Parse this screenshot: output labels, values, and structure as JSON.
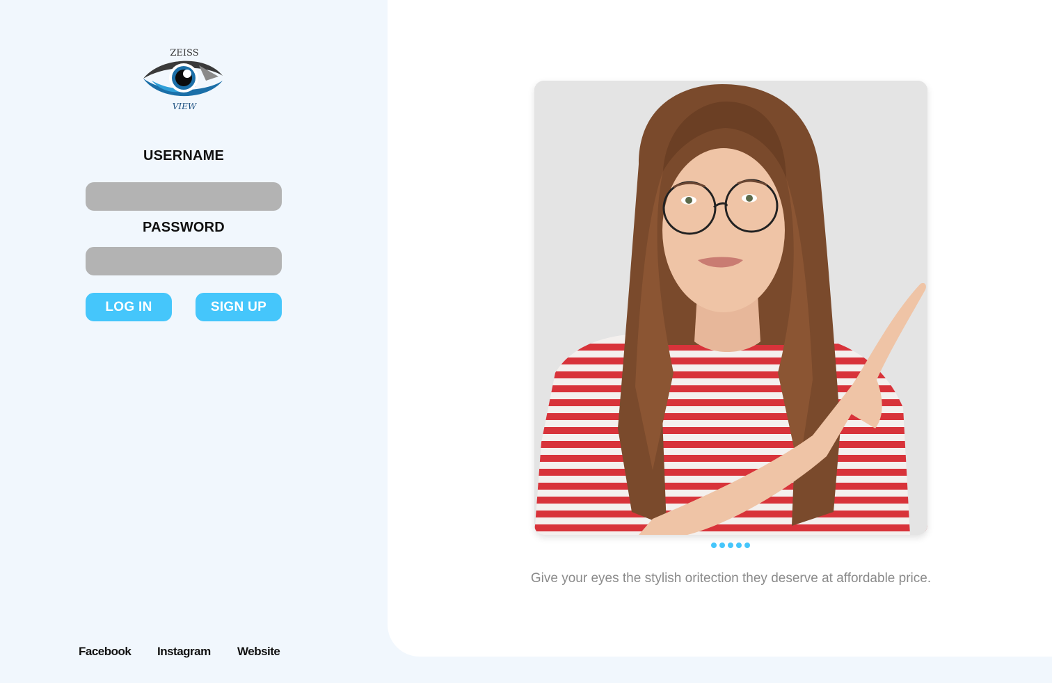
{
  "brand": {
    "top_text": "ZEISS",
    "bottom_text": "VIEW",
    "colors": {
      "blue": "#1b6fa8",
      "dark": "#3a3a3a",
      "grey": "#8a8a8a"
    }
  },
  "login_form": {
    "username_label": "USERNAME",
    "username_value": "",
    "password_label": "PASSWORD",
    "password_value": "",
    "login_label": "LOG IN",
    "signup_label": "SIGN UP"
  },
  "footer": {
    "links": [
      "Facebook",
      "Instagram",
      "Website"
    ]
  },
  "carousel": {
    "image_icon": "woman-with-glasses-pointing-photo",
    "slide_count": 5,
    "tagline": "Give your eyes the stylish oritection they deserve at affordable price."
  },
  "colors": {
    "accent": "#45c6fb",
    "left_background": "#f1f7fd",
    "input_fill": "#b3b3b3",
    "card_background": "#ffffff",
    "tagline_text": "#8a8a8a"
  }
}
